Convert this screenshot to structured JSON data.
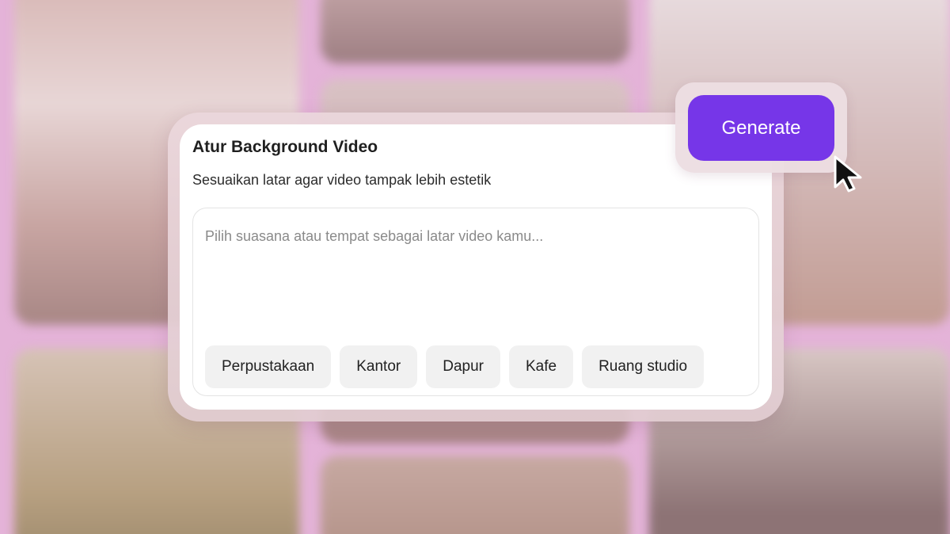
{
  "card": {
    "title": "Atur Background Video",
    "subtitle": "Sesuaikan latar agar video tampak lebih estetik",
    "prompt": {
      "value": "",
      "placeholder": "Pilih suasana atau tempat sebagai latar video kamu..."
    },
    "chips": [
      {
        "label": "Perpustakaan"
      },
      {
        "label": "Kantor"
      },
      {
        "label": "Dapur"
      },
      {
        "label": "Kafe"
      },
      {
        "label": "Ruang studio"
      }
    ]
  },
  "generate_button": {
    "label": "Generate"
  },
  "icons": {
    "cursor": "mouse-pointer-icon"
  },
  "colors": {
    "accent": "#7636e8",
    "background": "#e4b3d8",
    "card": "#ffffff",
    "chip": "#f1f1f1"
  }
}
